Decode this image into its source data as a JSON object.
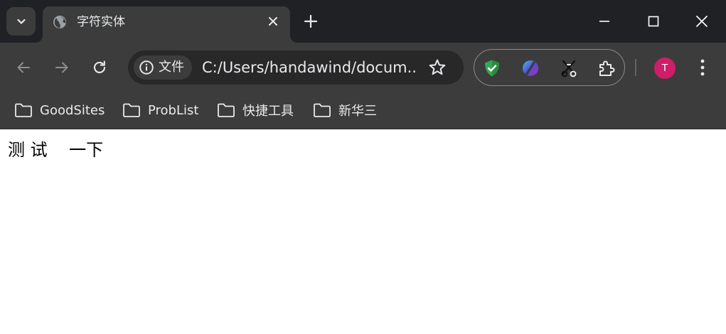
{
  "tab": {
    "title": "字符实体"
  },
  "omnibox": {
    "chip_label": "文件",
    "url": "C:/Users/handawind/docum..."
  },
  "profile": {
    "initial": "T",
    "color": "#d01d6a"
  },
  "bookmarks": [
    {
      "label": "GoodSites"
    },
    {
      "label": "ProbList"
    },
    {
      "label": "快捷工具"
    },
    {
      "label": "新华三"
    }
  ],
  "page": {
    "text": "测 试    一下"
  },
  "icons": {
    "tab_search": "chevron-down-icon",
    "favicon": "globe-icon",
    "tab_close": "close-icon",
    "new_tab": "plus-icon",
    "back": "arrow-left-icon",
    "forward": "arrow-right-icon",
    "reload": "reload-icon",
    "site_info": "info-icon",
    "bookmark": "star-icon",
    "extensions": [
      "shield-check-icon",
      "gradient-slash-icon",
      "scissors-icon",
      "puzzle-icon"
    ],
    "menu": "kebab-menu-icon"
  },
  "colors": {
    "frame": "#202124",
    "toolbar": "#3c3c3c",
    "omnibox": "#282828",
    "text": "#e8eaed"
  }
}
